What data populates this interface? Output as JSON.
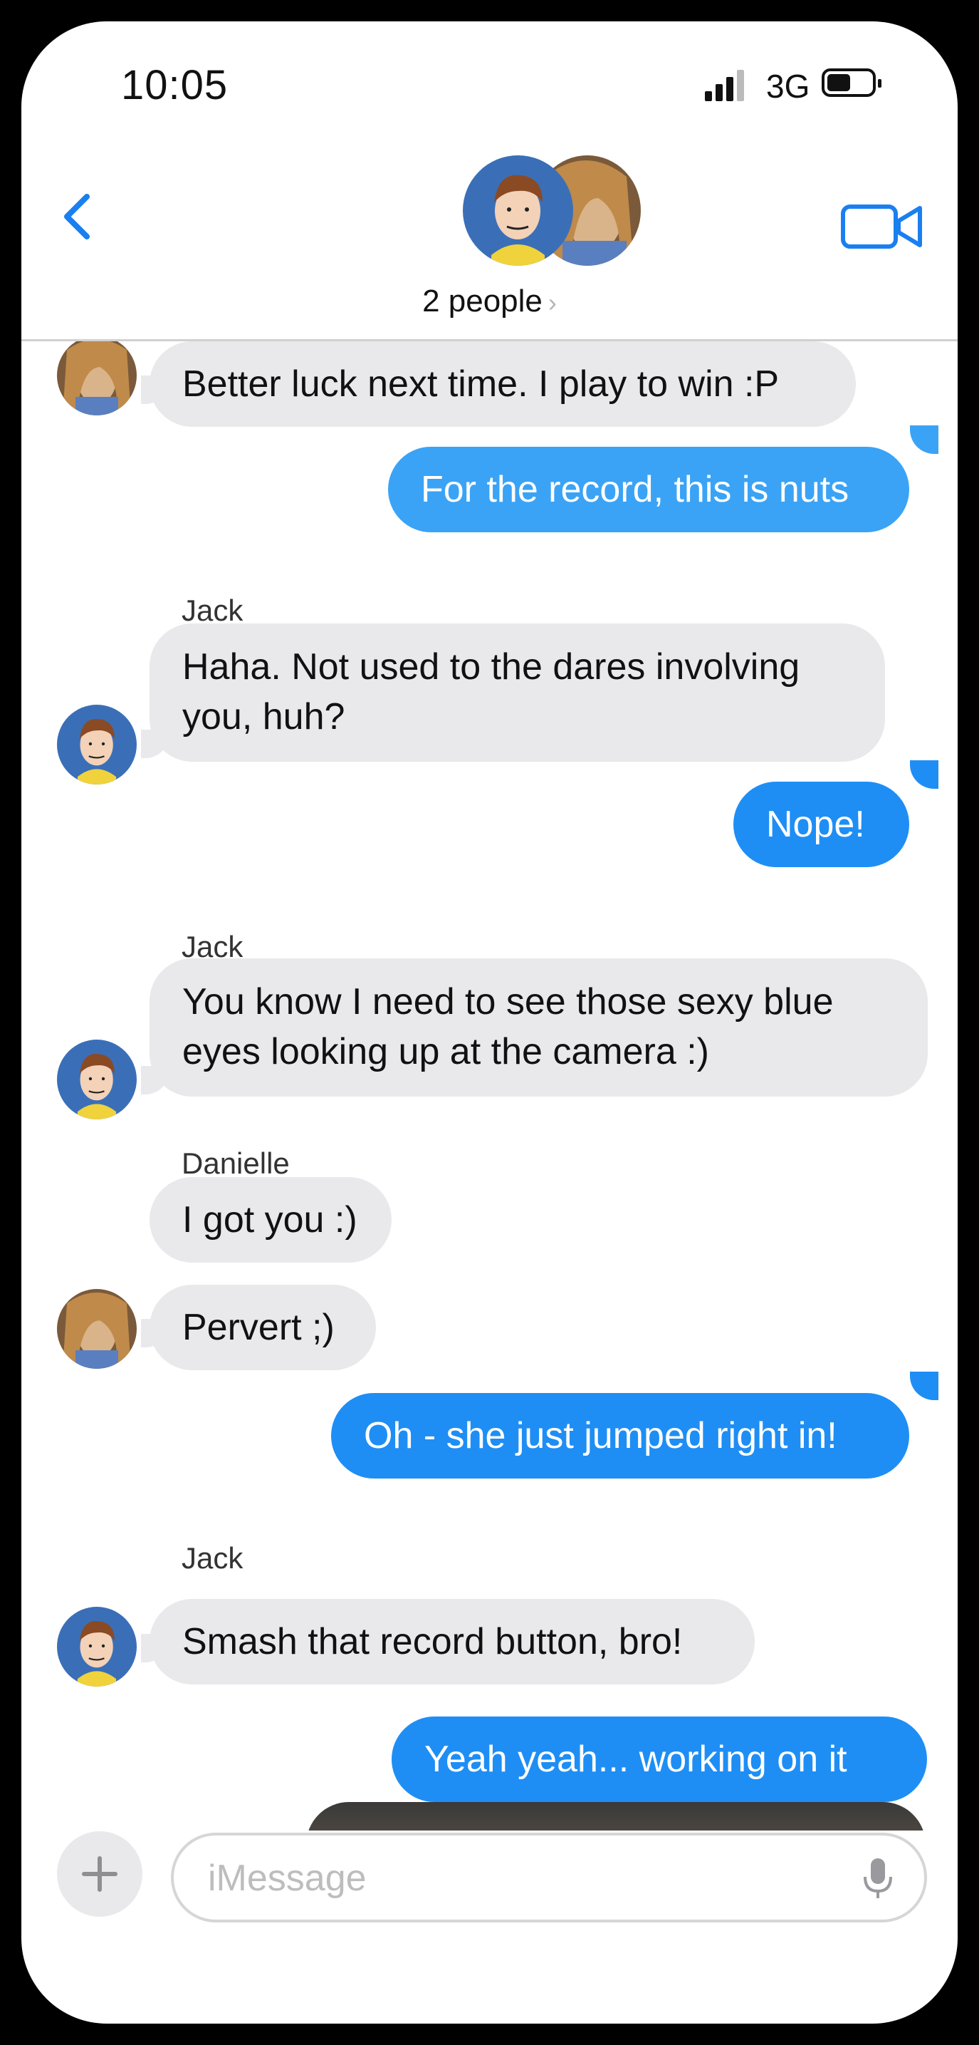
{
  "status": {
    "time": "10:05",
    "network": "3G"
  },
  "header": {
    "people_label": "2 people",
    "chevron": "›"
  },
  "messages": [
    {
      "text": "Better luck next time.  I play to win :P"
    },
    {
      "text": "For the record, this is nuts"
    },
    {
      "sender": "Jack",
      "line1": "Haha.  Not used to the dares involving",
      "line2": "you, huh?"
    },
    {
      "text": "Nope!"
    },
    {
      "sender": "Jack",
      "line1": "You know I need to see those sexy blue",
      "line2": "eyes looking up at the camera :)"
    },
    {
      "sender": "Danielle",
      "text": "I got you :)"
    },
    {
      "text": "Pervert ;)"
    },
    {
      "text": "Oh - she just jumped right in!"
    },
    {
      "sender": "Jack",
      "text": "Smash that record button, bro!"
    },
    {
      "text": "Yeah yeah... working on it"
    }
  ],
  "composer": {
    "placeholder": "iMessage",
    "plus_icon": "plus-icon",
    "mic_icon": "mic-icon"
  },
  "colors": {
    "outgoing": "#1e8ef5",
    "incoming": "#e9e9eb",
    "accent": "#1a7ff0"
  }
}
